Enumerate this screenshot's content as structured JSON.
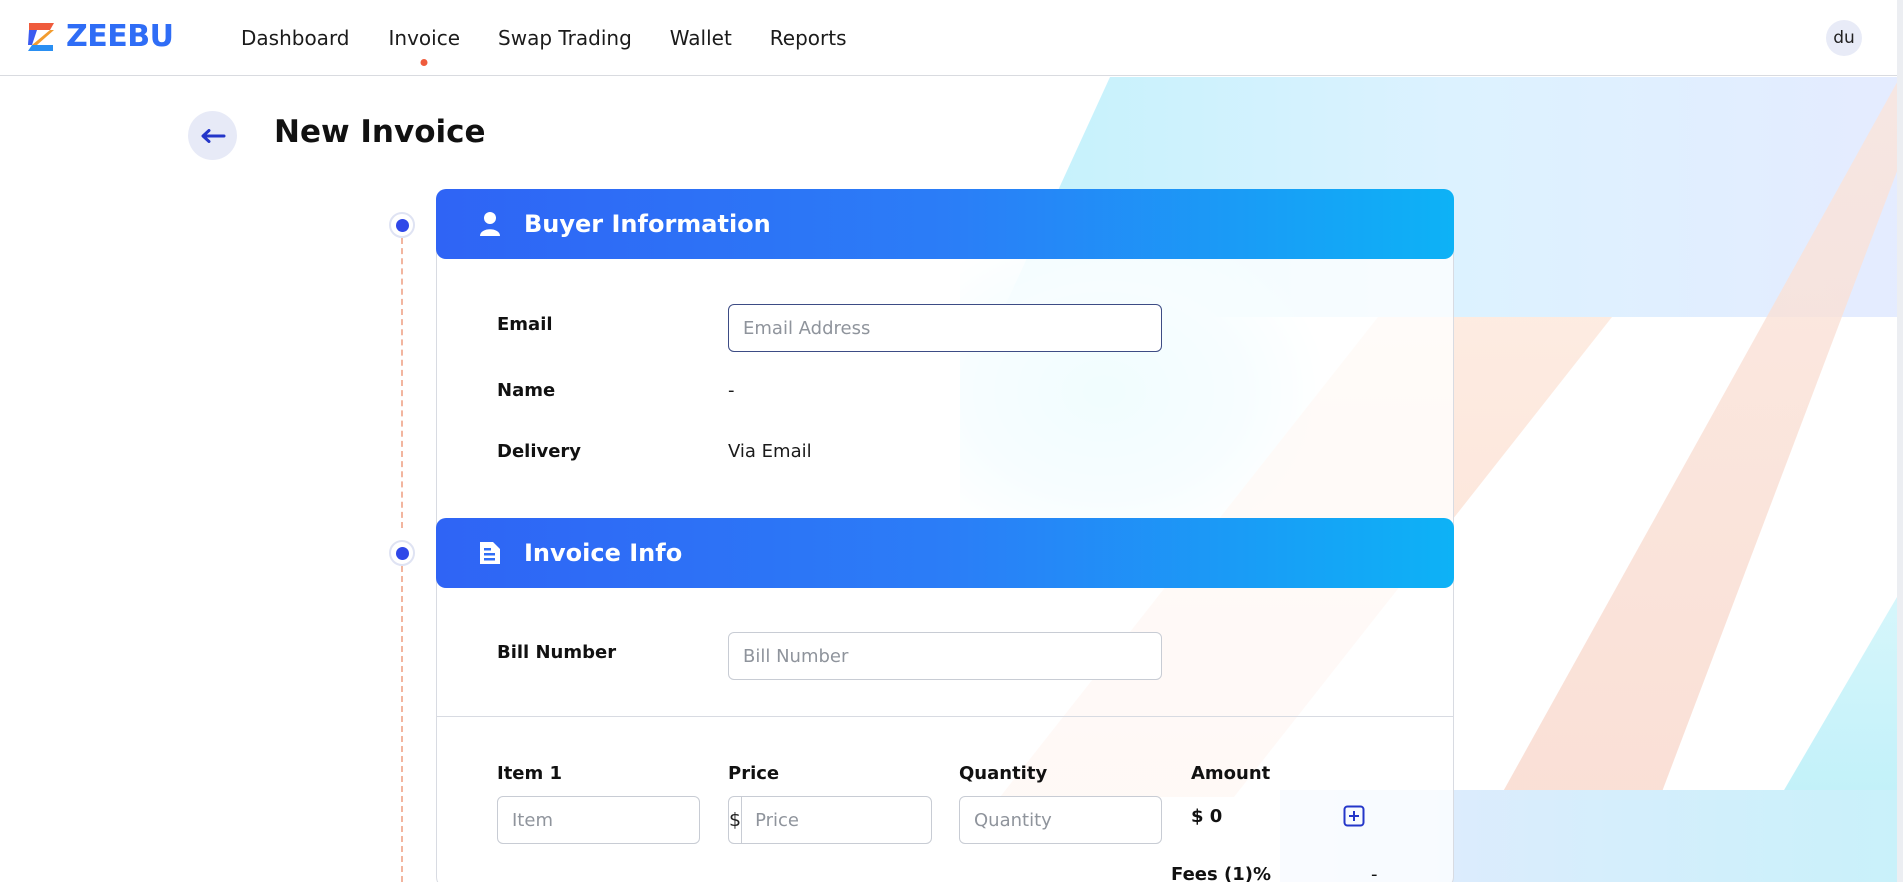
{
  "brand": {
    "name": "ZEEBU"
  },
  "nav": {
    "items": [
      {
        "label": "Dashboard"
      },
      {
        "label": "Invoice",
        "active": true
      },
      {
        "label": "Swap Trading"
      },
      {
        "label": "Wallet"
      },
      {
        "label": "Reports"
      }
    ],
    "avatar_initials": "du"
  },
  "page": {
    "title": "New Invoice"
  },
  "buyer_section": {
    "title": "Buyer Information",
    "email_label": "Email",
    "email_placeholder": "Email Address",
    "email_value": "",
    "name_label": "Name",
    "name_value": "-",
    "delivery_label": "Delivery",
    "delivery_value": "Via Email"
  },
  "invoice_section": {
    "title": "Invoice Info",
    "bill_label": "Bill Number",
    "bill_placeholder": "Bill Number",
    "item_label": "Item 1",
    "item_placeholder": "Item",
    "price_label": "Price",
    "currency_symbol": "$",
    "price_placeholder": "Price",
    "quantity_label": "Quantity",
    "quantity_placeholder": "Quantity",
    "amount_label": "Amount",
    "amount_value": "$ 0",
    "fees_label": "Fees (1)%",
    "fees_value": "-"
  },
  "colors": {
    "brand_blue": "#2f6df6",
    "accent_dot": "#ef5b3c",
    "section_gradient_start": "#2f64f5",
    "section_gradient_end": "#0db2f6",
    "timeline_dot": "#3048e8"
  }
}
